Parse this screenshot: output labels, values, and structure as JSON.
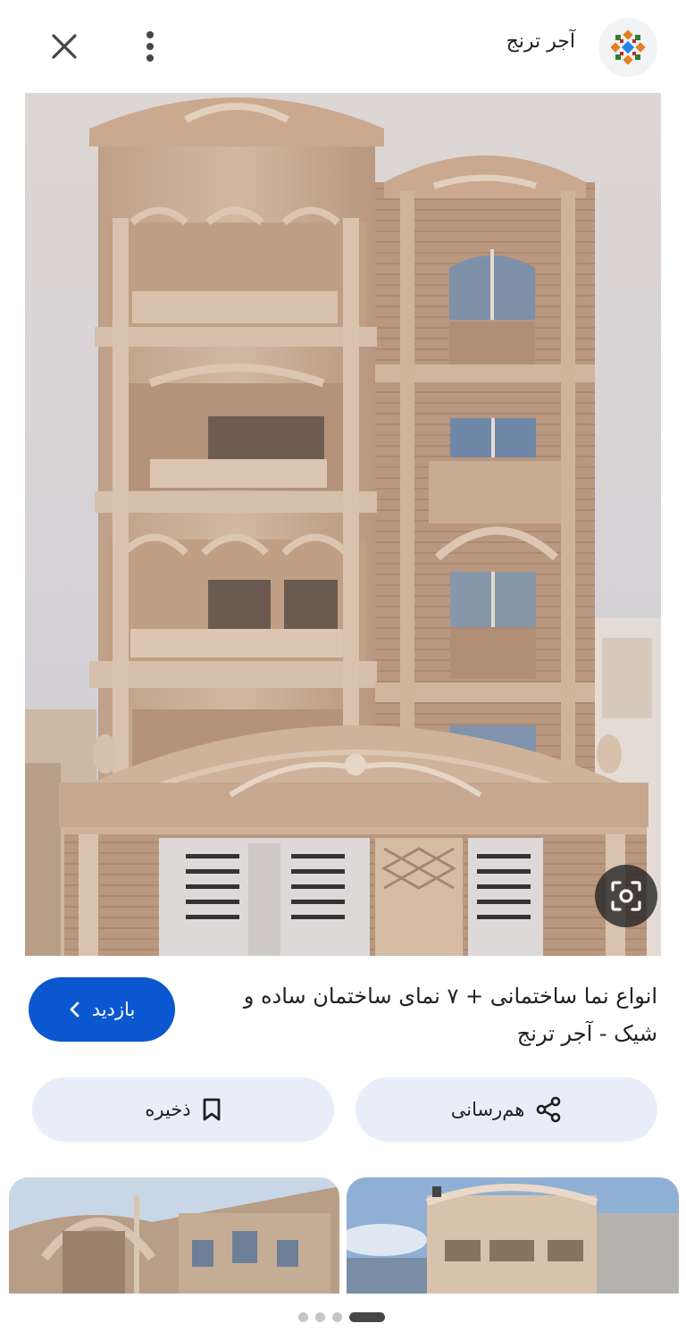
{
  "header": {
    "site_name": "آجر ترنج",
    "close_icon": "close-icon",
    "more_icon": "more-vert-icon",
    "logo_icon": "site-logo-icon"
  },
  "result": {
    "title": "انواع نما ساختمانی + ۷ نمای ساختمان ساده و شیک - آجر ترنج",
    "visit_label": "بازدید",
    "visit_icon": "chevron-left-icon",
    "save_label": "ذخیره",
    "save_icon": "bookmark-icon",
    "share_label": "هم‌رسانی",
    "share_icon": "share-icon",
    "lens_icon": "lens-icon"
  },
  "carousel": {
    "dot_count": 4,
    "active_dot": 3
  },
  "colors": {
    "accent": "#0b57d0",
    "pill_background": "#e8eef9",
    "facade": "#c6aa92"
  }
}
